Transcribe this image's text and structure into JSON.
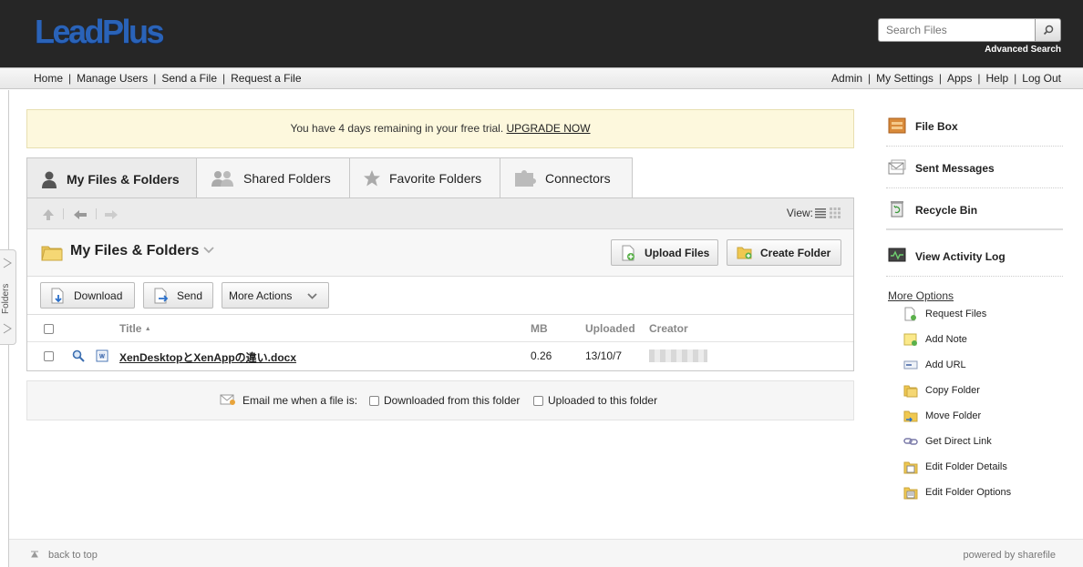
{
  "header": {
    "logo_text": "LeadPlus",
    "search_placeholder": "Search Files",
    "advanced_search": "Advanced Search"
  },
  "nav": {
    "left": [
      "Home",
      "Manage Users",
      "Send a File",
      "Request a File"
    ],
    "right": [
      "Admin",
      "My Settings",
      "Apps",
      "Help",
      "Log Out"
    ]
  },
  "rail": {
    "label": "Folders"
  },
  "trial": {
    "message": "You have 4 days remaining in your free trial.",
    "upgrade": "UPGRADE NOW"
  },
  "tabs": [
    "My Files & Folders",
    "Shared Folders",
    "Favorite Folders",
    "Connectors"
  ],
  "panel": {
    "view_label": "View:",
    "folder_title": "My Files & Folders",
    "upload_button": "Upload Files",
    "create_button": "Create Folder",
    "download_button": "Download",
    "send_button": "Send",
    "more_actions": "More Actions",
    "columns": {
      "title": "Title",
      "title_sort": "▲",
      "mb": "MB",
      "uploaded": "Uploaded",
      "creator": "Creator"
    },
    "files": [
      {
        "name": "XenDesktopとXenAppの違い.docx",
        "mb": "0.26",
        "uploaded": "13/10/7"
      }
    ]
  },
  "email": {
    "label": "Email me when a file is:",
    "downloaded": "Downloaded from this folder",
    "uploaded": "Uploaded to this folder"
  },
  "sidebar": {
    "items": [
      "File Box",
      "Sent Messages",
      "Recycle Bin",
      "View Activity Log"
    ],
    "more_options": "More Options",
    "options": [
      "Request Files",
      "Add Note",
      "Add URL",
      "Copy Folder",
      "Move Folder",
      "Get Direct Link",
      "Edit Folder Details",
      "Edit Folder Options"
    ]
  },
  "footer": {
    "back_to_top": "back to top",
    "powered": "powered by sharefile"
  }
}
